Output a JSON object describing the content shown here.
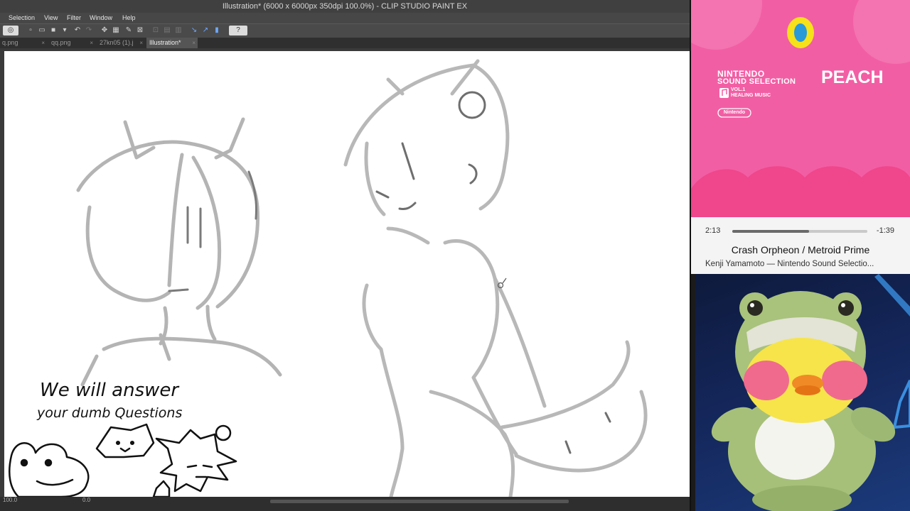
{
  "app": {
    "title": "Illustration* (6000 x 6000px 350dpi 100.0%)  - CLIP STUDIO PAINT EX",
    "menu": [
      "Selection",
      "View",
      "Filter",
      "Window",
      "Help"
    ],
    "tabs": [
      {
        "label": "q.png",
        "active": false
      },
      {
        "label": "qq.png",
        "active": false
      },
      {
        "label": "27kn05 (1).j",
        "active": false
      },
      {
        "label": "Illustration*",
        "active": true
      }
    ],
    "status": {
      "zoom": "100.0",
      "angle": "0.0"
    },
    "help_icon": "question-icon"
  },
  "canvas": {
    "handwriting_line1": "We will answer",
    "handwriting_line2": "your dumb Questions"
  },
  "album": {
    "brand_line1": "NINTENDO",
    "brand_line2": "SOUND SELECTION",
    "vol_line1": "VOL.1",
    "vol_line2": "HEALING MUSIC",
    "logo": "Nintendo",
    "character": "PEACH",
    "background_color": "#f25ea4",
    "ring_color": "#f5e21a",
    "ring_inner_color": "#2a9ad8"
  },
  "player": {
    "elapsed": "2:13",
    "remaining": "-1:39",
    "progress": 0.57,
    "title": "Crash Orpheon / Metroid Prime",
    "subtitle": "Kenji Yamamoto — Nintendo Sound Selectio..."
  }
}
